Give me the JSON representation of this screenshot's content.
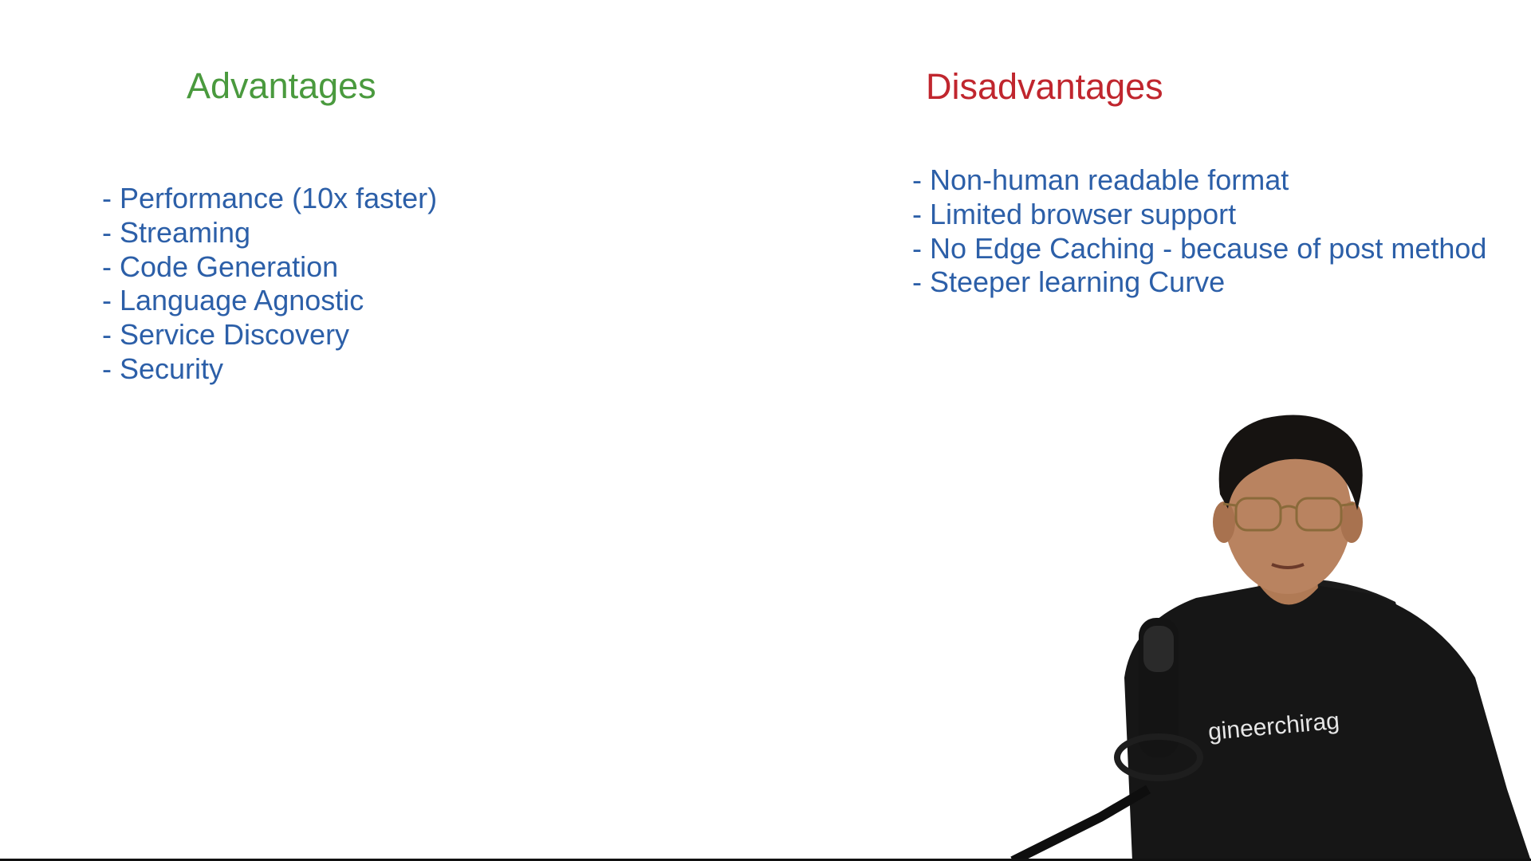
{
  "advantages": {
    "title": "Advantages",
    "items": [
      "- Performance (10x faster)",
      "- Streaming",
      "- Code Generation",
      "- Language Agnostic",
      "- Service Discovery",
      "- Security"
    ]
  },
  "disadvantages": {
    "title": "Disadvantages",
    "items": [
      "- Non-human readable format",
      "- Limited browser support",
      "- No Edge Caching - because of post method",
      "- Steeper learning Curve"
    ]
  },
  "presenter": {
    "shirt_text": "gineerchirag"
  },
  "colors": {
    "advantages_title": "#4a9a3e",
    "disadvantages_title": "#c0262e",
    "list_text": "#2c5fa8"
  }
}
